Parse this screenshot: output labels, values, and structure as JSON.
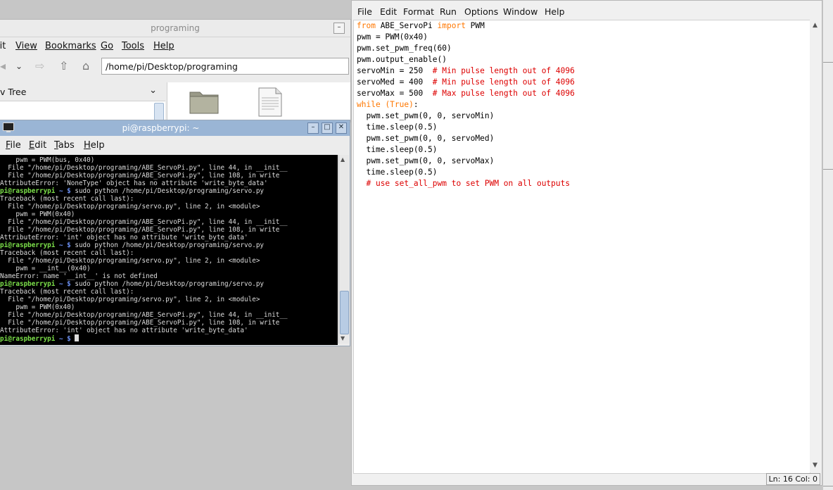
{
  "file_manager": {
    "title": "programing",
    "menu": [
      "lit",
      "View",
      "Bookmarks",
      "Go",
      "Tools",
      "Help"
    ],
    "path": "/home/pi/Desktop/programing",
    "sidepane_mode": "v Tree"
  },
  "terminal": {
    "title": "pi@raspberrypi: ~",
    "menu": [
      "File",
      "Edit",
      "Tabs",
      "Help"
    ],
    "prompt_user": "pi@raspberrypi",
    "prompt_dir": " ~ $",
    "lines": [
      {
        "t": "out",
        "text": "    pwm = PWM(bus, 0x40)"
      },
      {
        "t": "out",
        "text": "  File \"/home/pi/Desktop/programing/ABE_ServoPi.py\", line 44, in __init__"
      },
      {
        "t": "out",
        "text": "  File \"/home/pi/Desktop/programing/ABE_ServoPi.py\", line 108, in write"
      },
      {
        "t": "out",
        "text": "AttributeError: 'NoneType' object has no attribute 'write_byte_data'"
      },
      {
        "t": "cmd",
        "text": " sudo python /home/pi/Desktop/programing/servo.py"
      },
      {
        "t": "out",
        "text": "Traceback (most recent call last):"
      },
      {
        "t": "out",
        "text": "  File \"/home/pi/Desktop/programing/servo.py\", line 2, in <module>"
      },
      {
        "t": "out",
        "text": "    pwm = PWM(0x40)"
      },
      {
        "t": "out",
        "text": "  File \"/home/pi/Desktop/programing/ABE_ServoPi.py\", line 44, in __init__"
      },
      {
        "t": "out",
        "text": "  File \"/home/pi/Desktop/programing/ABE_ServoPi.py\", line 108, in write"
      },
      {
        "t": "out",
        "text": "AttributeError: 'int' object has no attribute 'write_byte_data'"
      },
      {
        "t": "cmd",
        "text": " sudo python /home/pi/Desktop/programing/servo.py"
      },
      {
        "t": "out",
        "text": "Traceback (most recent call last):"
      },
      {
        "t": "out",
        "text": "  File \"/home/pi/Desktop/programing/servo.py\", line 2, in <module>"
      },
      {
        "t": "out",
        "text": "    pwm = __int__(0x40)"
      },
      {
        "t": "out",
        "text": "NameError: name '__int__' is not defined"
      },
      {
        "t": "cmd",
        "text": " sudo python /home/pi/Desktop/programing/servo.py"
      },
      {
        "t": "out",
        "text": "Traceback (most recent call last):"
      },
      {
        "t": "out",
        "text": "  File \"/home/pi/Desktop/programing/servo.py\", line 2, in <module>"
      },
      {
        "t": "out",
        "text": "    pwm = PWM(0x40)"
      },
      {
        "t": "out",
        "text": "  File \"/home/pi/Desktop/programing/ABE_ServoPi.py\", line 44, in __init__"
      },
      {
        "t": "out",
        "text": "  File \"/home/pi/Desktop/programing/ABE_ServoPi.py\", line 108, in write"
      },
      {
        "t": "out",
        "text": "AttributeError: 'int' object has no attribute 'write_byte_data'"
      },
      {
        "t": "cmd",
        "text": ""
      }
    ]
  },
  "idle": {
    "menu": [
      "File",
      "Edit",
      "Format",
      "Run",
      "Options",
      "Window",
      "Help"
    ],
    "code": [
      [
        [
          "kw",
          "from"
        ],
        [
          "tx",
          " ABE_ServoPi "
        ],
        [
          "kw",
          "import"
        ],
        [
          "tx",
          " PWM"
        ]
      ],
      [
        [
          "tx",
          "pwm = PWM(0x40)"
        ]
      ],
      [
        [
          "tx",
          "pwm.set_pwm_freq(60)"
        ]
      ],
      [
        [
          "tx",
          "pwm.output_enable()"
        ]
      ],
      [
        [
          "tx",
          "servoMin = 250  "
        ],
        [
          "cm",
          "# Min pulse length out of 4096"
        ]
      ],
      [
        [
          "tx",
          "servoMed = 400  "
        ],
        [
          "cm",
          "# Min pulse length out of 4096"
        ]
      ],
      [
        [
          "tx",
          "servoMax = 500  "
        ],
        [
          "cm",
          "# Max pulse length out of 4096"
        ]
      ],
      [
        [
          "kw",
          "while"
        ],
        [
          "tx",
          " "
        ],
        [
          "kw",
          "(True)"
        ],
        [
          "tx",
          ":"
        ]
      ],
      [
        [
          "tx",
          "  pwm.set_pwm(0, 0, servoMin)"
        ]
      ],
      [
        [
          "tx",
          "  time.sleep(0.5)"
        ]
      ],
      [
        [
          "tx",
          "  pwm.set_pwm(0, 0, servoMed)"
        ]
      ],
      [
        [
          "tx",
          "  time.sleep(0.5)"
        ]
      ],
      [
        [
          "tx",
          "  pwm.set_pwm(0, 0, servoMax)"
        ]
      ],
      [
        [
          "tx",
          "  time.sleep(0.5)"
        ]
      ],
      [
        [
          "tx",
          "  "
        ],
        [
          "cm",
          "# use set_all_pwm to set PWM on all outputs"
        ]
      ]
    ],
    "status": "Ln: 16  Col: 0"
  }
}
